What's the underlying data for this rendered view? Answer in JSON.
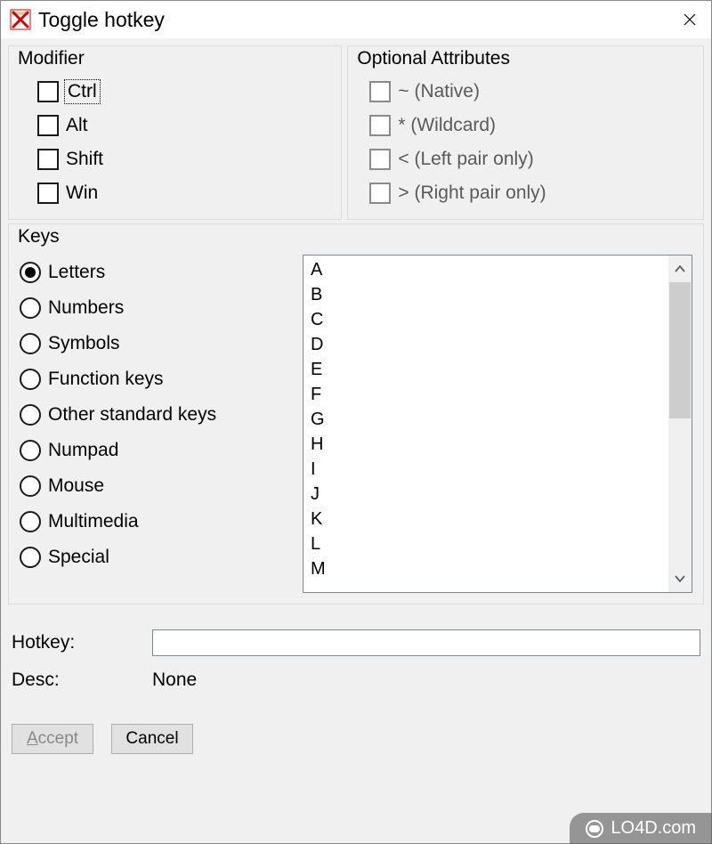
{
  "window": {
    "title": "Toggle hotkey"
  },
  "modifier": {
    "title": "Modifier",
    "items": [
      {
        "label": "Ctrl",
        "checked": false,
        "focused": true
      },
      {
        "label": "Alt",
        "checked": false,
        "focused": false
      },
      {
        "label": "Shift",
        "checked": false,
        "focused": false
      },
      {
        "label": "Win",
        "checked": false,
        "focused": false
      }
    ]
  },
  "optional_attributes": {
    "title": "Optional Attributes",
    "items": [
      {
        "label": "~ (Native)",
        "checked": false
      },
      {
        "label": "* (Wildcard)",
        "checked": false
      },
      {
        "label": "< (Left pair only)",
        "checked": false
      },
      {
        "label": "> (Right pair only)",
        "checked": false
      }
    ]
  },
  "keys": {
    "title": "Keys",
    "categories": [
      {
        "label": "Letters",
        "selected": true
      },
      {
        "label": "Numbers",
        "selected": false
      },
      {
        "label": "Symbols",
        "selected": false
      },
      {
        "label": "Function keys",
        "selected": false
      },
      {
        "label": "Other standard keys",
        "selected": false
      },
      {
        "label": "Numpad",
        "selected": false
      },
      {
        "label": "Mouse",
        "selected": false
      },
      {
        "label": "Multimedia",
        "selected": false
      },
      {
        "label": "Special",
        "selected": false
      }
    ],
    "list": [
      "A",
      "B",
      "C",
      "D",
      "E",
      "F",
      "G",
      "H",
      "I",
      "J",
      "K",
      "L",
      "M"
    ]
  },
  "hotkey": {
    "label": "Hotkey:",
    "value": ""
  },
  "desc": {
    "label": "Desc:",
    "value": "None"
  },
  "buttons": {
    "accept": "Accept",
    "cancel": "Cancel"
  },
  "watermark": "LO4D.com"
}
